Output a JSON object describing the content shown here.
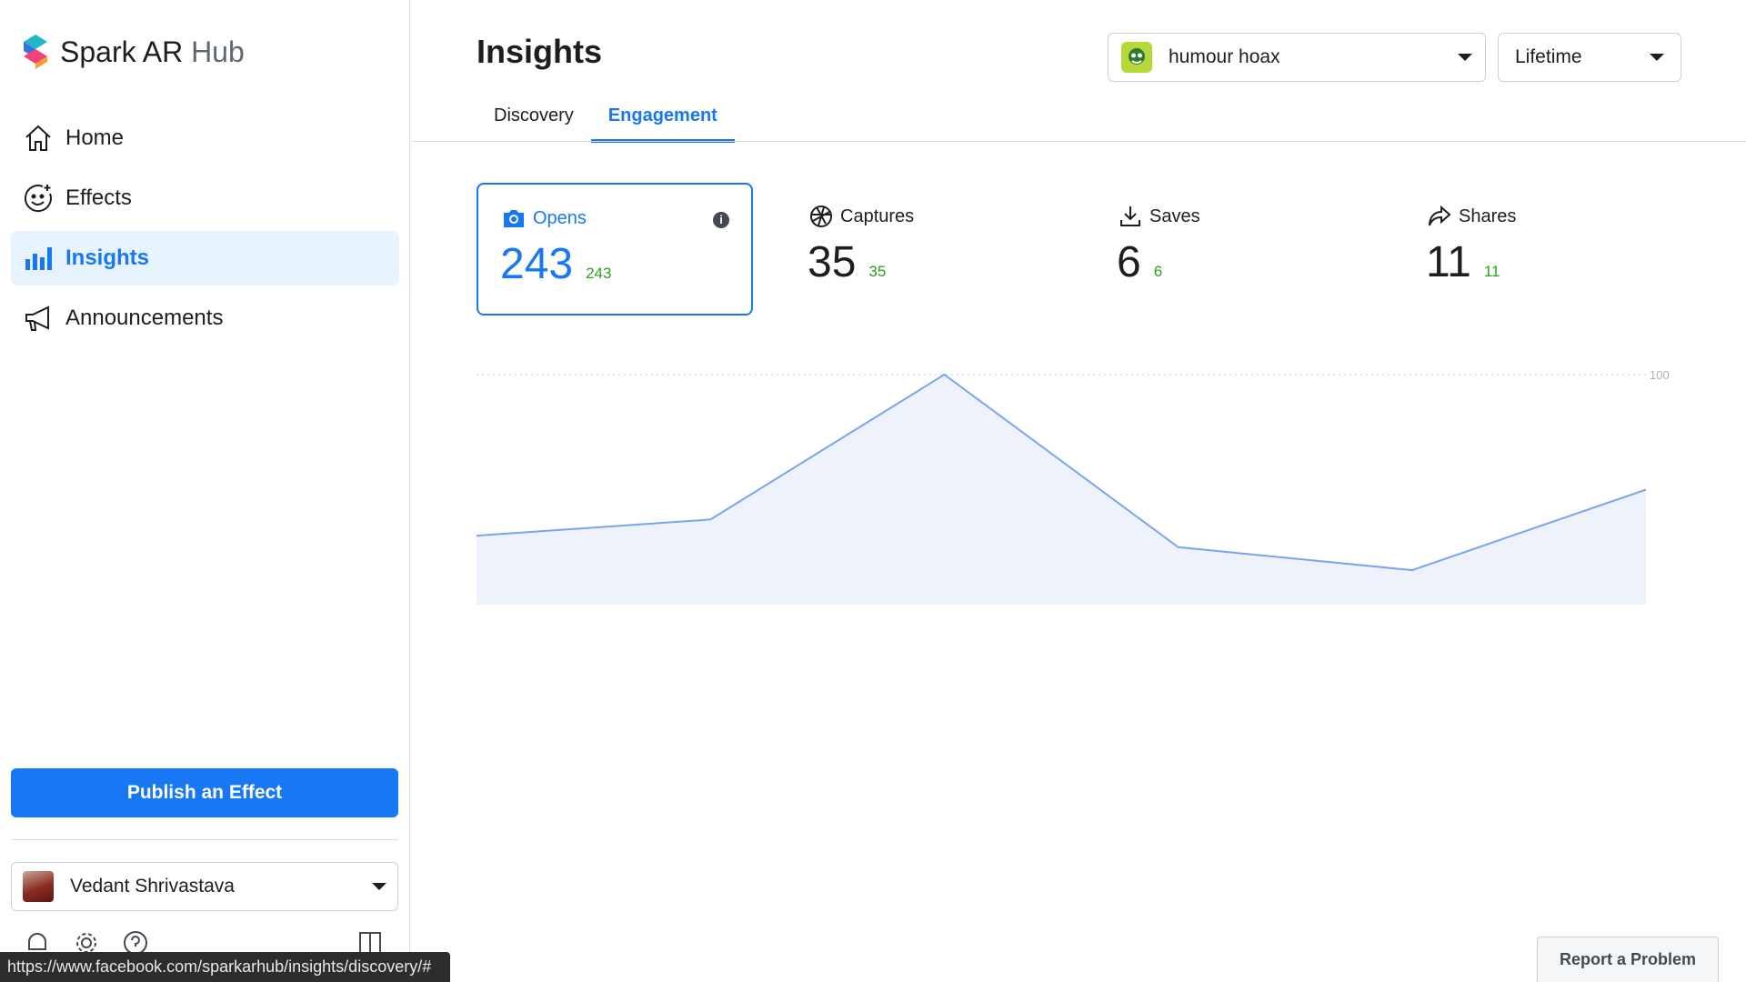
{
  "app": {
    "name_main": "Spark AR",
    "name_sub": "Hub"
  },
  "sidebar": {
    "items": [
      {
        "label": "Home",
        "icon": "home-icon",
        "active": false
      },
      {
        "label": "Effects",
        "icon": "effects-icon",
        "active": false
      },
      {
        "label": "Insights",
        "icon": "bar-chart-icon",
        "active": true
      },
      {
        "label": "Announcements",
        "icon": "megaphone-icon",
        "active": false
      }
    ],
    "publish_label": "Publish an Effect",
    "user": {
      "name": "Vedant Shrivastava"
    },
    "bottom_icons": [
      "bell-icon",
      "gear-icon",
      "help-icon",
      "book-icon"
    ]
  },
  "status_bar": {
    "url": "https://www.facebook.com/sparkarhub/insights/discovery/#"
  },
  "header": {
    "title": "Insights",
    "effect_select": {
      "value": "humour hoax"
    },
    "range_select": {
      "value": "Lifetime"
    }
  },
  "tabs": [
    {
      "label": "Discovery",
      "active": false
    },
    {
      "label": "Engagement",
      "active": true
    }
  ],
  "metrics": [
    {
      "label": "Opens",
      "value": "243",
      "delta": "243",
      "icon": "camera-icon",
      "active": true
    },
    {
      "label": "Captures",
      "value": "35",
      "delta": "35",
      "icon": "aperture-icon",
      "active": false
    },
    {
      "label": "Saves",
      "value": "6",
      "delta": "6",
      "icon": "download-icon",
      "active": false
    },
    {
      "label": "Shares",
      "value": "11",
      "delta": "11",
      "icon": "share-icon",
      "active": false
    }
  ],
  "chart_data": {
    "type": "area",
    "x": [
      1,
      2,
      3,
      4,
      5,
      6
    ],
    "series": [
      {
        "values": [
          30,
          37,
          100,
          25,
          15,
          50
        ]
      }
    ],
    "ylim": [
      0,
      100
    ],
    "yticks": [
      "100"
    ],
    "grid": true,
    "line_color": "#7ba3f2",
    "fill_color": "#eef3fb"
  },
  "footer": {
    "report_label": "Report a Problem"
  },
  "colors": {
    "accent": "#1877f2",
    "positive": "#2ca01c",
    "sidebar_active_bg": "#e7f3ff"
  }
}
